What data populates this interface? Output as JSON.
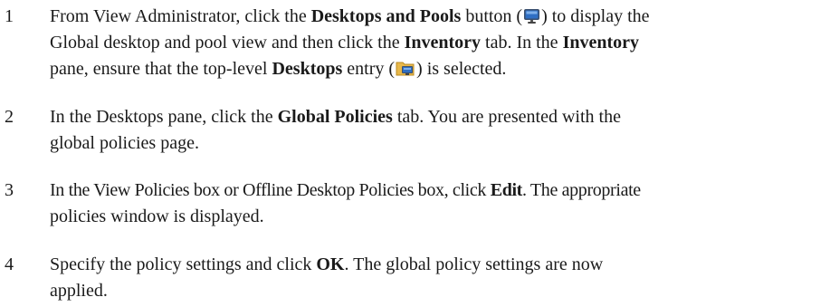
{
  "steps": [
    {
      "number": "1",
      "t1": "From View Administrator, click the ",
      "b1": "Desktops and Pools",
      "t2": " button (",
      "t3": ") to display the",
      "t4": "Global desktop and pool view and then click the ",
      "b2": "Inventory",
      "t5": " tab. In the ",
      "b3": "Inventory",
      "t6": "pane, ensure that the top-level ",
      "b4": "Desktops",
      "t7": " entry (",
      "t8": ") is selected.",
      "icons": [
        "desktop-monitor-icon",
        "desktops-folder-icon"
      ]
    },
    {
      "number": "2",
      "t1": "In the Desktops pane, click the ",
      "b1": "Global Policies",
      "t2": " tab. You are presented with the",
      "t3": "global policies page."
    },
    {
      "number": "3",
      "t1": "In the View Policies box or Offline Desktop Policies box, click ",
      "b1": "Edit",
      "t2": ". The appropriate",
      "t3": "policies window is displayed."
    },
    {
      "number": "4",
      "t1": "Specify the policy settings and click ",
      "b1": "OK",
      "t2": ". The global policy settings are now",
      "t3": "applied."
    }
  ],
  "colors": {
    "text": "#1a1a1a",
    "monitor_screen": "#2f6fc4",
    "folder": "#e8b84a"
  }
}
